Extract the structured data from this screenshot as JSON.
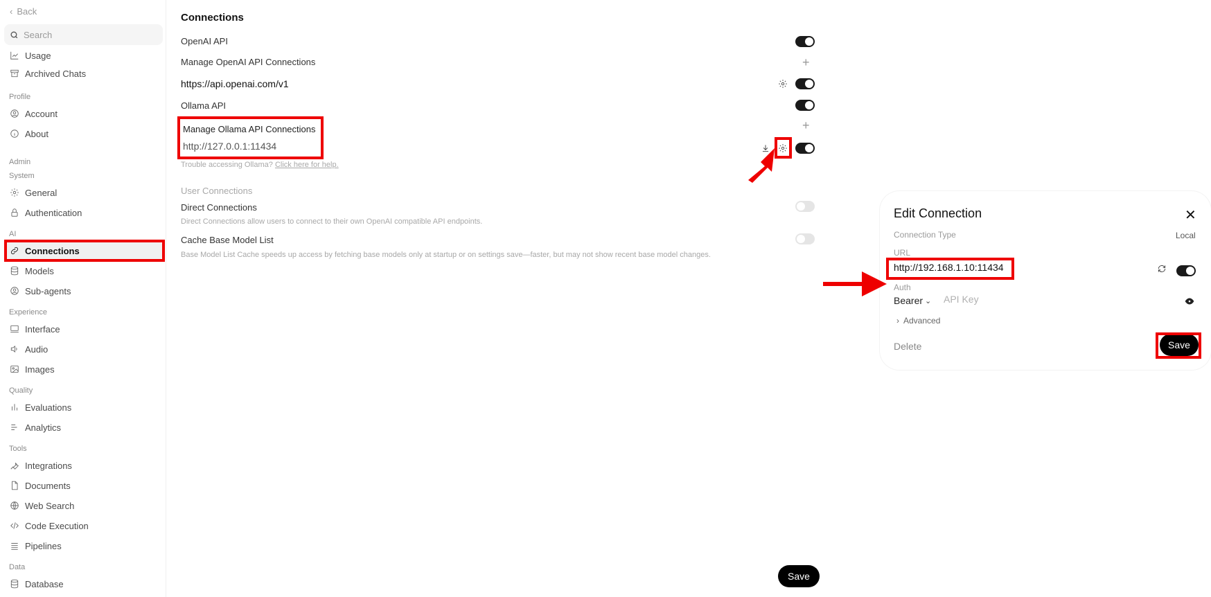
{
  "sidebar": {
    "back_label": "Back",
    "search_placeholder": "Search",
    "items": [
      {
        "label": "Usage",
        "icon": "chart-line-icon"
      },
      {
        "label": "Archived Chats",
        "icon": "archive-icon"
      },
      {
        "label": "Account",
        "icon": "user-circle-icon"
      },
      {
        "label": "About",
        "icon": "info-icon"
      },
      {
        "label": "General",
        "icon": "gear-icon"
      },
      {
        "label": "Authentication",
        "icon": "lock-icon"
      },
      {
        "label": "Connections",
        "icon": "link-icon"
      },
      {
        "label": "Models",
        "icon": "database-icon"
      },
      {
        "label": "Sub-agents",
        "icon": "user-circle-icon"
      },
      {
        "label": "Interface",
        "icon": "monitor-icon"
      },
      {
        "label": "Audio",
        "icon": "speaker-icon"
      },
      {
        "label": "Images",
        "icon": "image-icon"
      },
      {
        "label": "Evaluations",
        "icon": "bar-chart-icon"
      },
      {
        "label": "Analytics",
        "icon": "list-chart-icon"
      },
      {
        "label": "Integrations",
        "icon": "wrench-icon"
      },
      {
        "label": "Documents",
        "icon": "document-icon"
      },
      {
        "label": "Web Search",
        "icon": "globe-icon"
      },
      {
        "label": "Code Execution",
        "icon": "code-icon"
      },
      {
        "label": "Pipelines",
        "icon": "layers-icon"
      },
      {
        "label": "Database",
        "icon": "database-icon"
      }
    ],
    "sections": {
      "profile": "Profile",
      "admin": "Admin",
      "system": "System",
      "ai": "AI",
      "experience": "Experience",
      "quality": "Quality",
      "tools": "Tools",
      "data": "Data"
    }
  },
  "main": {
    "title": "Connections",
    "openai_api_label": "OpenAI API",
    "manage_openai_label": "Manage OpenAI API Connections",
    "openai_url": "https://api.openai.com/v1",
    "ollama_api_label": "Ollama API",
    "manage_ollama_label": "Manage Ollama API Connections",
    "ollama_url": "http://127.0.0.1:11434",
    "trouble_text": "Trouble accessing Ollama?",
    "help_link": "Click here for help.",
    "user_connections_label": "User Connections",
    "direct_connections_label": "Direct Connections",
    "direct_connections_desc": "Direct Connections allow users to connect to their own OpenAI compatible API endpoints.",
    "cache_label": "Cache Base Model List",
    "cache_desc": "Base Model List Cache speeds up access by fetching base models only at startup or on settings save—faster, but may not show recent base model changes.",
    "save_label": "Save",
    "toggles": {
      "openai_api": true,
      "openai_connection": true,
      "ollama_api": true,
      "ollama_connection": true,
      "direct_connections": false,
      "cache_base_model_list": false
    }
  },
  "modal": {
    "title": "Edit Connection",
    "connection_type_label": "Connection Type",
    "connection_type_value": "Local",
    "url_label": "URL",
    "url_value": "http://192.168.1.10:11434",
    "auth_label": "Auth",
    "auth_type": "Bearer",
    "api_key_placeholder": "API Key",
    "advanced_label": "Advanced",
    "delete_label": "Delete",
    "save_label": "Save",
    "connection_enabled": true
  },
  "annotation_color": "#ee0000"
}
